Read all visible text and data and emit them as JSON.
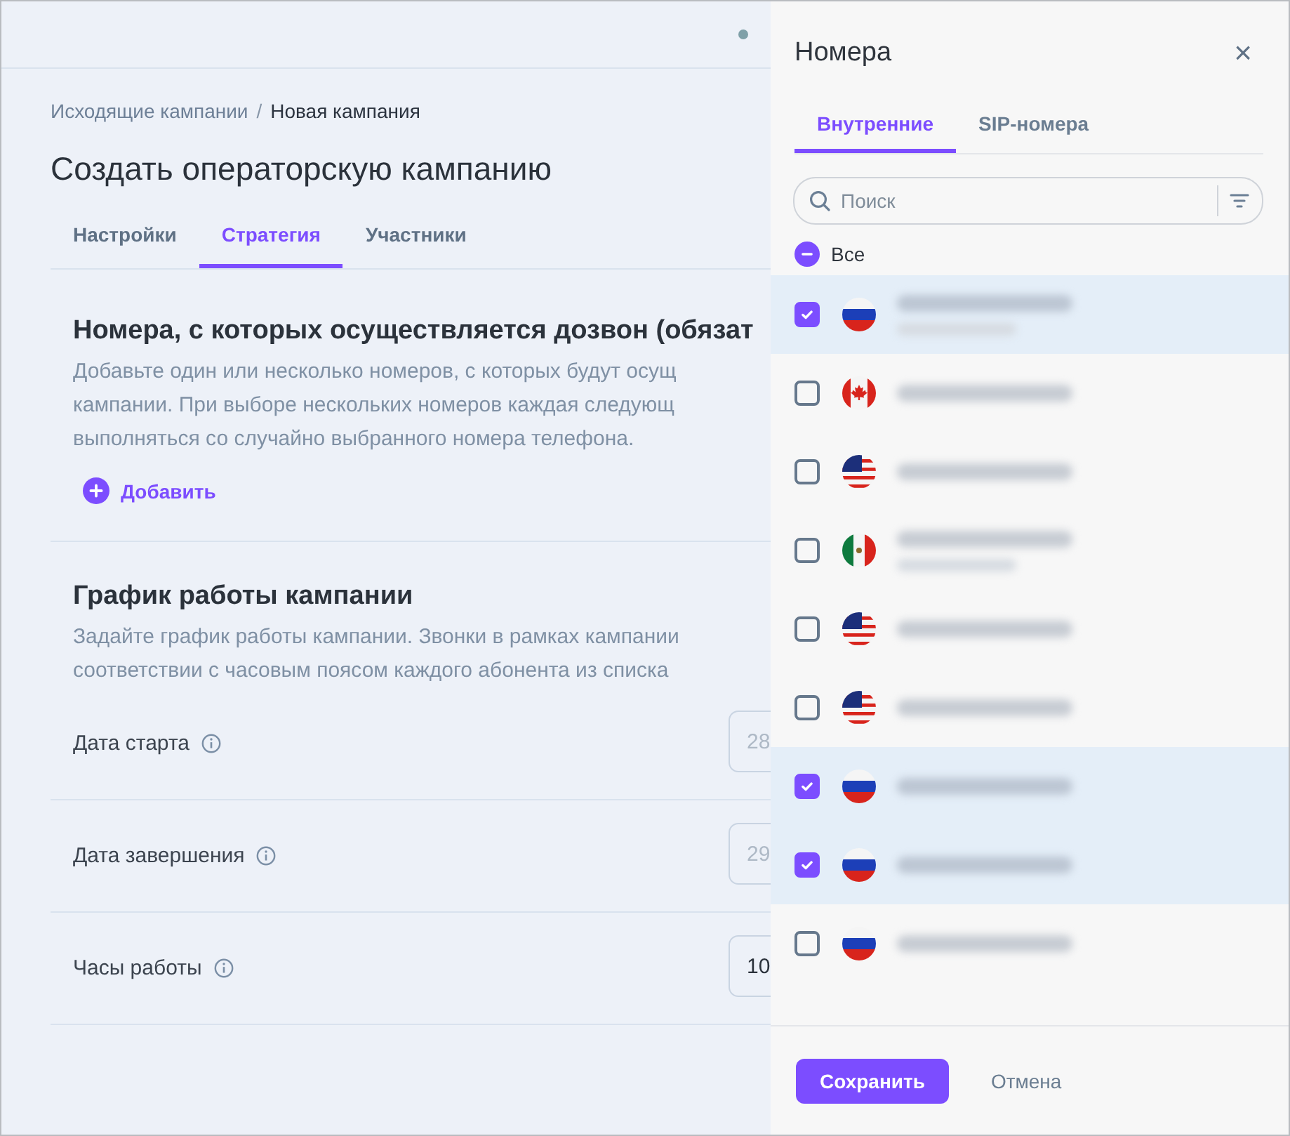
{
  "top_bar": {
    "status_dot": {
      "color": "#7fa0a8"
    }
  },
  "breadcrumbs": [
    {
      "label": "Исходящие кампании",
      "current": false
    },
    {
      "label": "Новая кампания",
      "current": true
    }
  ],
  "breadcrumb_separator": "/",
  "page_title": "Создать операторскую кампанию",
  "tabs": [
    {
      "label": "Настройки",
      "selected": false
    },
    {
      "label": "Стратегия",
      "selected": true
    },
    {
      "label": "Участники",
      "selected": false
    }
  ],
  "sections": [
    {
      "title": "Номера, с которых осуществляется дозвон (обязат",
      "description_lines": [
        "Добавьте один или несколько номеров, с которых будут осущ",
        "кампании. При выборе нескольких номеров каждая следующ",
        "выполняться со случайно выбранного номера телефона."
      ],
      "add_link": "Добавить"
    },
    {
      "title": "График работы кампании",
      "description_lines": [
        "Задайте график работы кампании. Звонки в рамках кампании",
        "соответствии с часовым поясом каждого абонента из списка"
      ]
    }
  ],
  "fields": [
    {
      "label": "Дата старта",
      "placeholder": "28"
    },
    {
      "label": "Дата завершения",
      "placeholder": "29"
    },
    {
      "label": "Часы работы",
      "value": "10"
    }
  ],
  "drawer": {
    "title": "Номера",
    "close": "×",
    "tabs": [
      {
        "label": "Внутренние",
        "selected": true
      },
      {
        "label": "SIP-номера",
        "selected": false
      }
    ],
    "search": {
      "placeholder": "Поиск"
    },
    "select_all": {
      "label": "Все",
      "indeterminate": true
    },
    "numbers": [
      {
        "kind": "ru",
        "checked": true,
        "subline": true
      },
      {
        "kind": "ca",
        "checked": false,
        "subline": false
      },
      {
        "kind": "us",
        "checked": false,
        "subline": false
      },
      {
        "kind": "mx",
        "checked": false,
        "subline": true
      },
      {
        "kind": "us",
        "checked": false,
        "subline": false
      },
      {
        "kind": "us",
        "checked": false,
        "subline": false
      },
      {
        "kind": "ru",
        "checked": true,
        "subline": false
      },
      {
        "kind": "ru",
        "checked": true,
        "subline": false
      },
      {
        "kind": "ru",
        "checked": false,
        "subline": false
      }
    ],
    "save": "Сохранить",
    "cancel": "Отмена"
  }
}
